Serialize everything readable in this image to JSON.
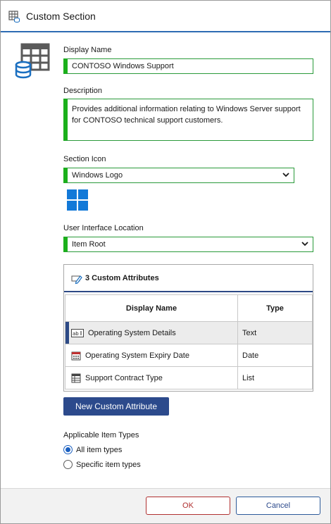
{
  "window": {
    "title": "Custom Section",
    "title_icon": "table-grid-icon",
    "section_graphic_icon": "table-database-icon"
  },
  "form": {
    "display_name_label": "Display Name",
    "display_name_value": "CONTOSO Windows Support",
    "description_label": "Description",
    "description_value": "Provides additional information relating to Windows Server support for CONTOSO technical support customers.",
    "section_icon_label": "Section Icon",
    "section_icon_value": "Windows Logo",
    "section_icon_preview": "windows-logo-icon",
    "ui_location_label": "User Interface Location",
    "ui_location_value": "Item Root"
  },
  "attributes": {
    "header": "3 Custom Attributes",
    "header_icon": "pencil-icon",
    "columns": [
      "Display Name",
      "Type"
    ],
    "rows": [
      {
        "name": "Operating System Details",
        "type": "Text",
        "icon": "text-field-icon",
        "selected": true
      },
      {
        "name": "Operating System Expiry Date",
        "type": "Date",
        "icon": "calendar-icon",
        "selected": false
      },
      {
        "name": "Support Contract Type",
        "type": "List",
        "icon": "list-icon",
        "selected": false
      }
    ],
    "new_button": "New Custom Attribute"
  },
  "item_types": {
    "label": "Applicable Item Types",
    "options": [
      {
        "label": "All item types",
        "selected": true
      },
      {
        "label": "Specific item types",
        "selected": false
      }
    ]
  },
  "footer": {
    "ok": "OK",
    "cancel": "Cancel"
  },
  "colors": {
    "accent_green": "#1bb01b",
    "primary_blue": "#2c4a8c",
    "ok_red": "#b03030",
    "windows_blue": "#1279d8"
  }
}
